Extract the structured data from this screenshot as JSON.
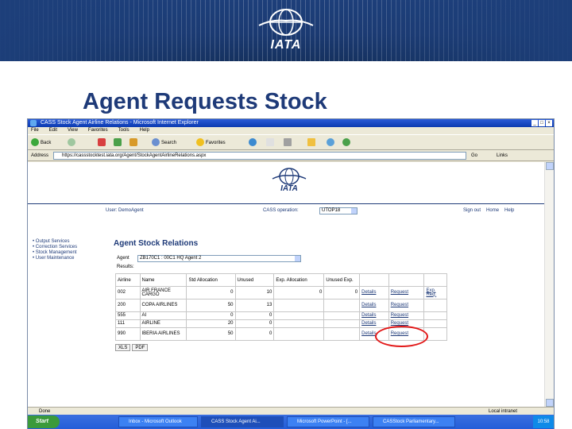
{
  "banner": {
    "logo_text": "IATA"
  },
  "slide": {
    "title": "Agent Requests Stock"
  },
  "browser": {
    "window_title": "CASS Stock Agent Airline Relations - Microsoft Internet Explorer",
    "menu": [
      "File",
      "Edit",
      "View",
      "Favorites",
      "Tools",
      "Help"
    ],
    "toolbar": {
      "back": "Back",
      "search": "Search",
      "favorites": "Favorites"
    },
    "address_label": "Address",
    "address_value": "https://cassstocktest.iata.org/Agent/StockAgentAirlineRelations.aspx",
    "go_label": "Go",
    "links_label": "Links"
  },
  "page": {
    "logo_text": "IATA",
    "user_label": "User: DemoAgent",
    "operation_label": "CASS operation:",
    "operation_value": "UTOP18",
    "top_links": [
      "Sign out",
      "Home",
      "Help"
    ],
    "side_menu": [
      "Output Services",
      "Correction Services",
      "Stock Management",
      "User Maintenance"
    ],
    "section_title": "Agent Stock Relations",
    "agent_label": "Agent",
    "agent_value": "ZB170C1 : 00C1 HQ Agent 2",
    "results_label": "Results:",
    "table": {
      "headers": [
        "Airline",
        "Name",
        "Std Allocation",
        "Unused",
        "Exp. Allocation",
        "Unused Exp.",
        "",
        "",
        ""
      ],
      "rows": [
        [
          "002",
          "AIR FRANCE CARGO",
          "0",
          "10",
          "0",
          "0",
          "Details",
          "Request",
          "Exp. Req."
        ],
        [
          "200",
          "COPA AIRLINES",
          "50",
          "13",
          "",
          "",
          "Details",
          "Request",
          ""
        ],
        [
          "555",
          "AI",
          "0",
          "0",
          "",
          "",
          "Details",
          "Request",
          ""
        ],
        [
          "111",
          "AIRLINE",
          "20",
          "0",
          "",
          "",
          "Details",
          "Request",
          ""
        ],
        [
          "990",
          "IBERIA AIRLINES",
          "50",
          "0",
          "",
          "",
          "Details",
          "Request",
          ""
        ]
      ]
    },
    "pager": [
      "XLS",
      "PDF"
    ]
  },
  "status": {
    "left": "Done",
    "zone": "Local intranet"
  },
  "taskbar": {
    "start": "Start",
    "tasks": [
      "Inbox - Microsoft Outlook",
      "CASS Stock Agent Ai...",
      "Microsoft PowerPoint - [...",
      "CASStock Parliamentary..."
    ],
    "clock": "10:58"
  },
  "colors": {
    "brand_blue": "#1e3a78",
    "highlight_red": "#e21818"
  }
}
